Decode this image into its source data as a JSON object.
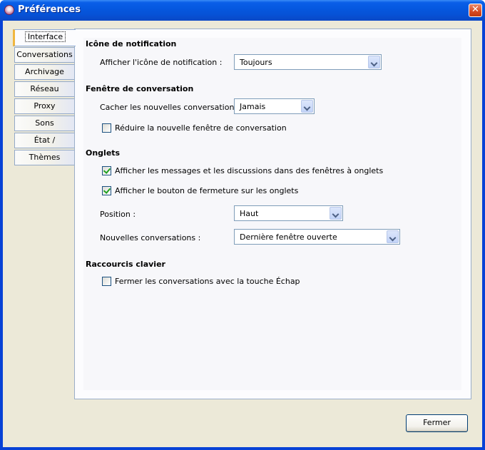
{
  "window": {
    "title": "Préférences",
    "close_glyph": "✕"
  },
  "tabs": [
    {
      "label": "Interface"
    },
    {
      "label": "Conversations"
    },
    {
      "label": "Archivage"
    },
    {
      "label": "Réseau"
    },
    {
      "label": "Proxy"
    },
    {
      "label": "Sons"
    },
    {
      "label": "État / Inactivité"
    },
    {
      "label": "Thèmes"
    }
  ],
  "notification": {
    "heading": "Icône de notification",
    "show_label": "Afficher l'icône de notification :",
    "show_value": "Toujours"
  },
  "conversation_window": {
    "heading": "Fenêtre de conversation",
    "hide_label": "Cacher les nouvelles conversations :",
    "hide_value": "Jamais",
    "minimize_label": "Réduire la nouvelle fenêtre de conversation",
    "minimize_checked": false
  },
  "tabs_section": {
    "heading": "Onglets",
    "tabbed_label": "Afficher les messages et les discussions dans des fenêtres à onglets",
    "tabbed_checked": true,
    "close_button_label": "Afficher le bouton de fermeture sur les onglets",
    "close_button_checked": true,
    "position_label": "Position :",
    "position_value": "Haut",
    "new_conv_label": "Nouvelles conversations :",
    "new_conv_value": "Dernière fenêtre ouverte"
  },
  "shortcuts": {
    "heading": "Raccourcis clavier",
    "escape_label": "Fermer les conversations avec la touche Échap",
    "escape_checked": false
  },
  "footer": {
    "close_label": "Fermer"
  }
}
